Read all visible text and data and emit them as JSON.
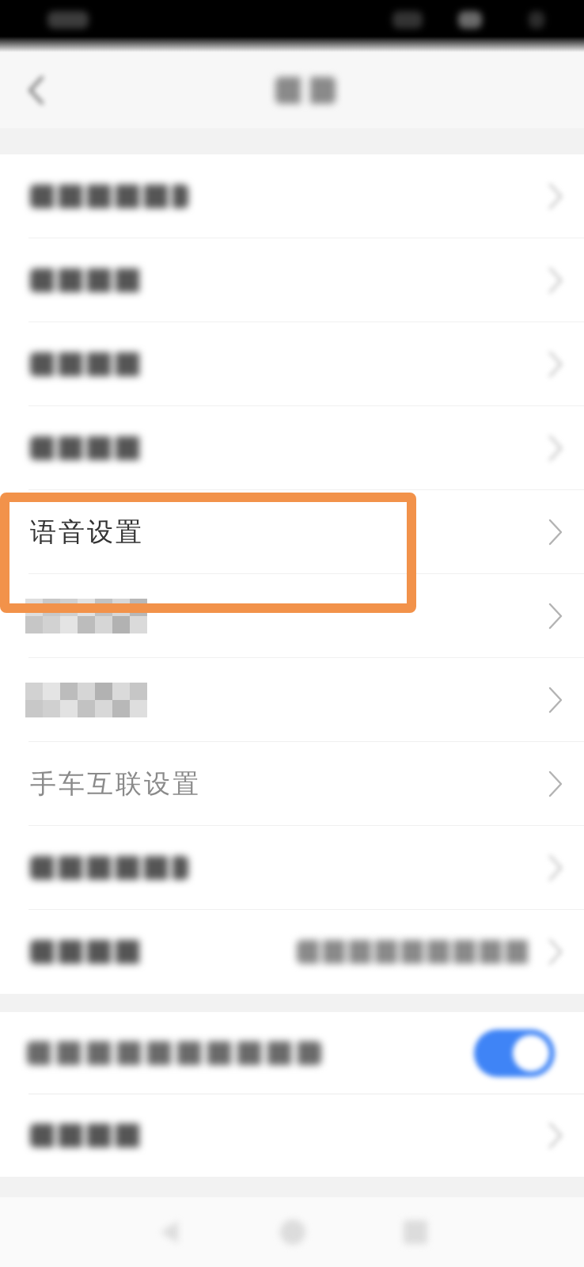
{
  "sections": [
    {
      "rows": [
        {
          "kind": "blurred-wide",
          "highlighted": false
        },
        {
          "kind": "blurred",
          "highlighted": false
        },
        {
          "kind": "blurred",
          "highlighted": false
        },
        {
          "kind": "blurred",
          "highlighted": false
        },
        {
          "kind": "text",
          "label": "语音设置",
          "faded": false,
          "highlighted": true
        },
        {
          "kind": "mosaic",
          "highlighted": false
        },
        {
          "kind": "mosaic",
          "highlighted": false
        },
        {
          "kind": "text",
          "label": "手车互联设置",
          "faded": true,
          "highlighted": false
        },
        {
          "kind": "blurred-wide",
          "highlighted": false
        },
        {
          "kind": "blurred-value",
          "highlighted": false
        }
      ]
    },
    {
      "rows": [
        {
          "kind": "blurred-toggle",
          "on": true,
          "highlighted": false
        },
        {
          "kind": "blurred",
          "highlighted": false
        }
      ]
    }
  ]
}
